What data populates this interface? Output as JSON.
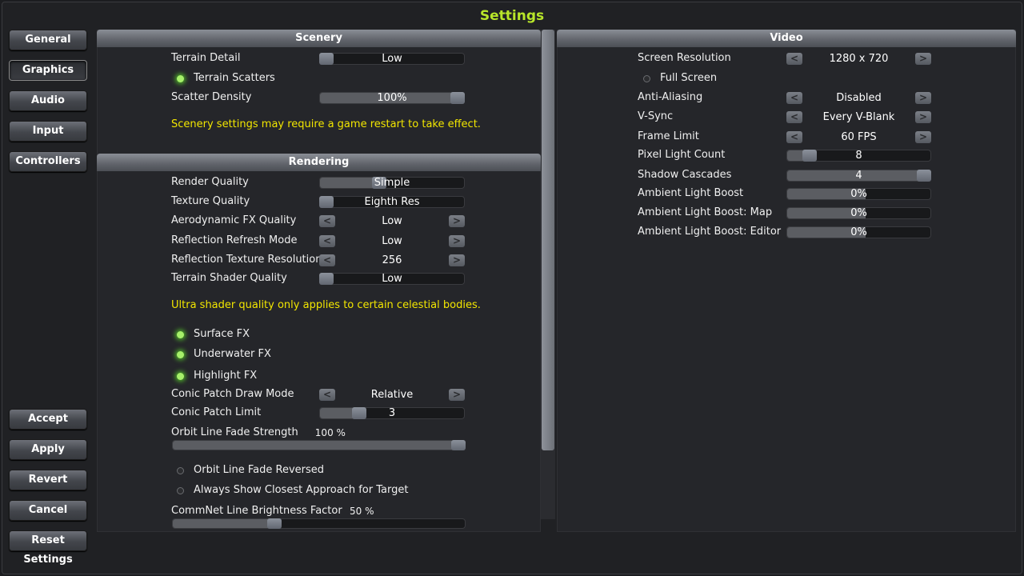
{
  "title": "Settings",
  "colors": {
    "title": "#b8e62a",
    "note": "#f2e600",
    "toggle_on": "#a6f06a"
  },
  "nav": {
    "top": [
      "General",
      "Graphics",
      "Audio",
      "Input",
      "Controllers"
    ],
    "selected": "Graphics",
    "bottom": [
      "Accept",
      "Apply",
      "Revert",
      "Cancel",
      "Reset Settings"
    ]
  },
  "scenery": {
    "header": "Scenery",
    "rows": [
      {
        "type": "slider",
        "label": "Terrain Detail",
        "value": "Low",
        "level": 0
      },
      {
        "type": "toggle",
        "label": "Terrain Scatters",
        "on": true
      },
      {
        "type": "slider",
        "label": "Scatter Density",
        "value": "100%",
        "level": 1
      },
      {
        "type": "note",
        "label": "Scenery settings may require a game restart to take effect."
      }
    ]
  },
  "rendering": {
    "header": "Rendering",
    "rows": [
      {
        "type": "slider",
        "label": "Render Quality",
        "value": "Simple",
        "level": 0.4
      },
      {
        "type": "slider",
        "label": "Texture Quality",
        "value": "Eighth Res",
        "level": 0
      },
      {
        "type": "stepper",
        "label": "Aerodynamic FX Quality",
        "value": "Low"
      },
      {
        "type": "stepper",
        "label": "Reflection Refresh Mode",
        "value": "Low"
      },
      {
        "type": "stepper",
        "label": "Reflection Texture Resolution",
        "value": "256"
      },
      {
        "type": "slider",
        "label": "Terrain Shader Quality",
        "value": "Low",
        "level": 0
      },
      {
        "type": "note",
        "label": "Ultra shader quality only applies to certain celestial bodies."
      },
      {
        "type": "toggle",
        "label": "Surface FX",
        "on": true
      },
      {
        "type": "toggle",
        "label": "Underwater FX",
        "on": true
      },
      {
        "type": "toggle",
        "label": "Highlight FX",
        "on": true
      },
      {
        "type": "stepper",
        "label": "Conic Patch Draw Mode",
        "value": "Relative"
      },
      {
        "type": "slider",
        "label": "Conic Patch Limit",
        "value": "3",
        "level": 0.25
      },
      {
        "type": "wide",
        "label": "Orbit Line Fade Strength",
        "value": "100 %",
        "level": 1
      },
      {
        "type": "toggle",
        "label": "Orbit Line Fade Reversed",
        "on": false
      },
      {
        "type": "toggle",
        "label": "Always Show Closest Approach for Target",
        "on": false
      },
      {
        "type": "wide",
        "label": "CommNet Line Brightness Factor",
        "value": "50 %",
        "level": 0.34
      }
    ]
  },
  "video": {
    "header": "Video",
    "rows": [
      {
        "type": "stepper",
        "label": "Screen Resolution",
        "value": "1280 x 720"
      },
      {
        "type": "toggle",
        "label": "Full Screen",
        "on": false
      },
      {
        "type": "stepper",
        "label": "Anti-Aliasing",
        "value": "Disabled"
      },
      {
        "type": "stepper",
        "label": "V-Sync",
        "value": "Every V-Blank"
      },
      {
        "type": "stepper",
        "label": "Frame Limit",
        "value": "60 FPS"
      },
      {
        "type": "slider",
        "label": "Pixel Light Count",
        "value": "8",
        "level": 0.12
      },
      {
        "type": "slider",
        "label": "Shadow Cascades",
        "value": "4",
        "level": 1
      },
      {
        "type": "fillonly",
        "label": "Ambient Light Boost",
        "value": "0%",
        "level": 0.54
      },
      {
        "type": "fillonly",
        "label": "Ambient Light Boost: Map",
        "value": "0%",
        "level": 0.54
      },
      {
        "type": "fillonly",
        "label": "Ambient Light Boost: Editor",
        "value": "0%",
        "level": 0.54
      }
    ]
  }
}
